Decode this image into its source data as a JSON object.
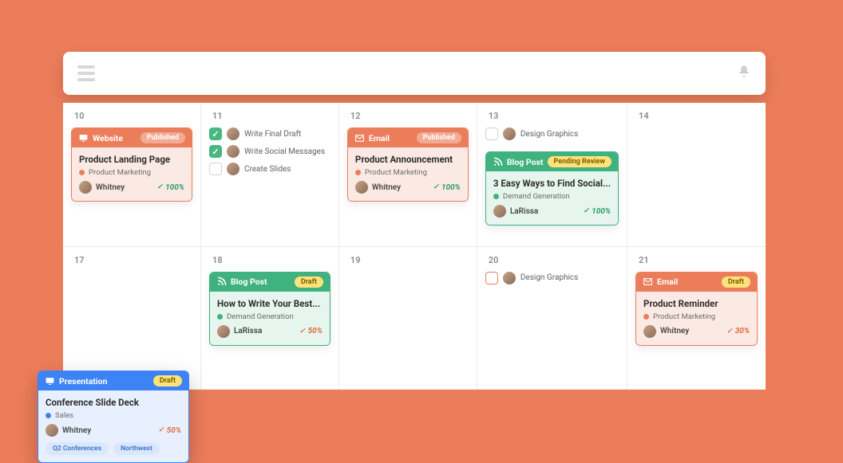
{
  "colors": {
    "accent_orange": "#ec7d5b",
    "accent_green": "#3fb27f",
    "accent_blue": "#3d83f5",
    "badge_yellow": "#ffe37a"
  },
  "topbar": {
    "menu": "menu",
    "notifications": "notifications"
  },
  "days": [
    "10",
    "11",
    "12",
    "13",
    "14",
    "17",
    "18",
    "19",
    "20",
    "21"
  ],
  "cards": {
    "website": {
      "type_label": "Website",
      "status": "Published",
      "title": "Product Landing Page",
      "category": "Product Marketing",
      "cat_color": "#ec7d5b",
      "owner": "Whitney",
      "pct": "100%",
      "pct_style": "green"
    },
    "email_announce": {
      "type_label": "Email",
      "status": "Published",
      "title": "Product Announcement",
      "category": "Product Marketing",
      "cat_color": "#ec7d5b",
      "owner": "Whitney",
      "pct": "100%",
      "pct_style": "green"
    },
    "blog_social": {
      "type_label": "Blog Post",
      "status": "Pending Review",
      "title": "3 Easy Ways to Find Social...",
      "category": "Demand Generation",
      "cat_color": "#3fb27f",
      "owner": "LaRissa",
      "pct": "100%",
      "pct_style": "green"
    },
    "presentation": {
      "type_label": "Presentation",
      "status": "Draft",
      "title": "Conference Slide Deck",
      "category": "Sales",
      "cat_color": "#3d83f5",
      "owner": "Whitney",
      "pct": "50%",
      "pct_style": "orange",
      "tags": [
        "Q2 Conferences",
        "Northwest"
      ]
    },
    "blog_best": {
      "type_label": "Blog Post",
      "status": "Draft",
      "title": "How to Write Your Best...",
      "category": "Demand Generation",
      "cat_color": "#3fb27f",
      "owner": "LaRissa",
      "pct": "50%",
      "pct_style": "orange"
    },
    "email_reminder": {
      "type_label": "Email",
      "status": "Draft",
      "title": "Product Reminder",
      "category": "Product Marketing",
      "cat_color": "#ec7d5b",
      "owner": "Whitney",
      "pct": "30%",
      "pct_style": "orange"
    }
  },
  "tasks": {
    "d11": [
      {
        "label": "Write Final Draft",
        "done": true
      },
      {
        "label": "Write Social Messages",
        "done": true
      },
      {
        "label": "Create Slides",
        "done": false
      }
    ],
    "d13": [
      {
        "label": "Design Graphics",
        "done": false
      }
    ],
    "d20": [
      {
        "label": "Design Graphics",
        "done": false,
        "orange": true
      }
    ]
  }
}
